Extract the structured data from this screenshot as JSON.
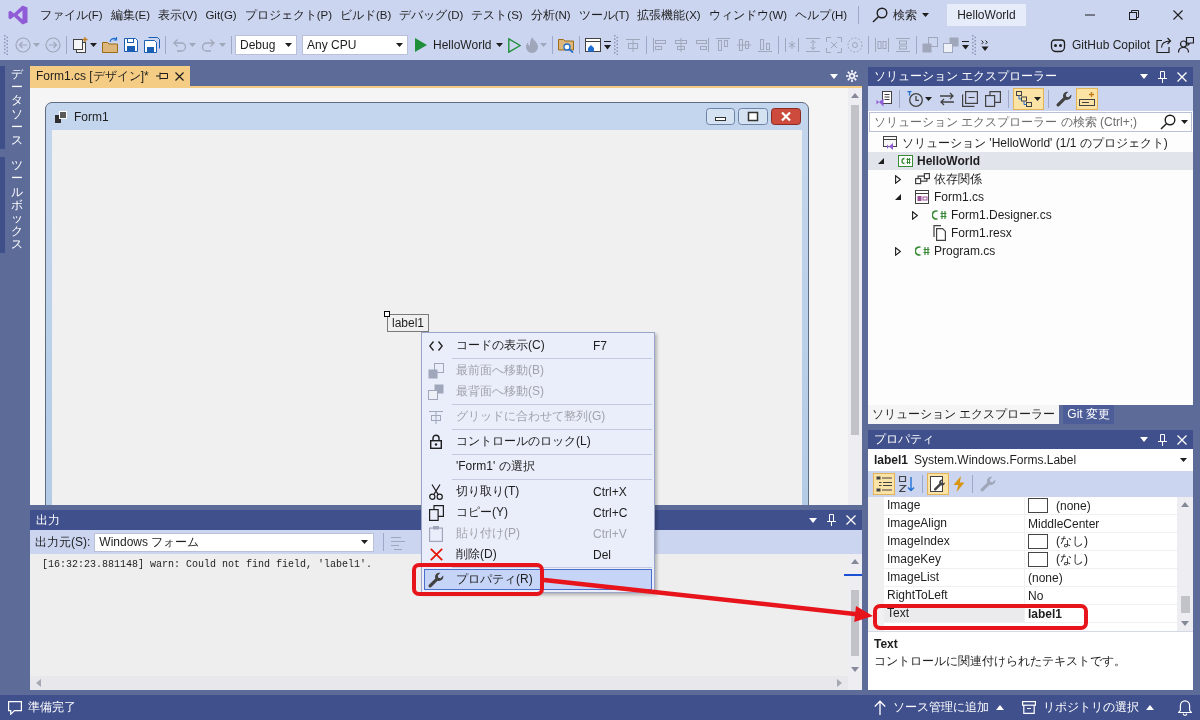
{
  "title_bar": {
    "menu": [
      "ファイル(F)",
      "編集(E)",
      "表示(V)",
      "Git(G)",
      "プロジェクト(P)",
      "ビルド(B)",
      "デバッグ(D)",
      "テスト(S)",
      "分析(N)",
      "ツール(T)",
      "拡張機能(X)",
      "ウィンドウ(W)",
      "ヘルプ(H)"
    ],
    "search": "検索",
    "solution": "HelloWorld"
  },
  "toolbar": {
    "bands": [
      {
        "collapsed": false,
        "groups": [
          [
            {
              "kind": "back",
              "disabled": true,
              "menu": true
            },
            {
              "kind": "forward",
              "disabled": true,
              "menu": false
            }
          ],
          [
            {
              "kind": "newitem",
              "disabled": false,
              "menu": true
            },
            {
              "kind": "open",
              "disabled": false,
              "menu": false
            },
            {
              "kind": "save",
              "disabled": false,
              "menu": false
            },
            {
              "kind": "saveall",
              "disabled": false,
              "menu": false
            }
          ],
          [
            {
              "kind": "undo",
              "disabled": true,
              "menu": true
            },
            {
              "kind": "redo",
              "disabled": true,
              "menu": true
            }
          ],
          [
            {
              "kind": "combo",
              "value": "Debug",
              "disabled": false,
              "menu": true
            },
            {
              "kind": "combo",
              "value": "Any CPU",
              "disabled": false,
              "menu": true
            },
            {
              "kind": "run",
              "label": "HelloWorld",
              "disabled": false,
              "menu": true
            },
            {
              "kind": "runnodebug",
              "disabled": false,
              "menu": false
            },
            {
              "kind": "hotreload",
              "disabled": true,
              "menu": true
            }
          ],
          [
            {
              "kind": "findfiles",
              "disabled": false,
              "menu": false
            }
          ],
          [
            {
              "kind": "window",
              "disabled": false,
              "menu": false
            }
          ]
        ]
      },
      {
        "collapsed": false,
        "groups": [
          [
            {
              "kind": "aligngrid",
              "disabled": true,
              "menu": false
            }
          ],
          [
            {
              "kind": "alignleft",
              "disabled": true,
              "menu": false
            },
            {
              "kind": "aligncenter",
              "disabled": true,
              "menu": false
            },
            {
              "kind": "alignright",
              "disabled": true,
              "menu": false
            },
            {
              "kind": "aligntop",
              "disabled": true,
              "menu": false
            },
            {
              "kind": "alignmiddle",
              "disabled": true,
              "menu": false
            },
            {
              "kind": "alignbottom",
              "disabled": true,
              "menu": false
            }
          ],
          [
            {
              "kind": "samewidth",
              "disabled": true,
              "menu": false
            },
            {
              "kind": "sameheight",
              "disabled": true,
              "menu": false
            },
            {
              "kind": "samesize",
              "disabled": true,
              "menu": false
            },
            {
              "kind": "sizegrid",
              "disabled": true,
              "menu": false
            }
          ],
          [
            {
              "kind": "hspace",
              "disabled": true,
              "menu": false
            },
            {
              "kind": "vspace",
              "disabled": true,
              "menu": false
            }
          ],
          [
            {
              "kind": "front",
              "disabled": true,
              "menu": false
            },
            {
              "kind": "sendback",
              "disabled": true,
              "menu": false
            }
          ]
        ]
      },
      {
        "collapsed": true
      }
    ],
    "extras": [
      {
        "kind": "copilot",
        "label": "GitHub Copilot"
      },
      {
        "kind": "share"
      },
      {
        "kind": "feedback"
      }
    ]
  },
  "side_tabs": [
    "データソース",
    "ツールボックス"
  ],
  "document": {
    "tabs": [
      {
        "label": "Form1.cs [デザイン]*",
        "selected": true
      }
    ],
    "form": {
      "title": "Form1",
      "controls": [
        {
          "kind": "label",
          "text": "label1",
          "selected": true
        }
      ]
    }
  },
  "context_menu": {
    "groups": [
      [
        {
          "label": "コードの表示(C)",
          "shortcut": "F7",
          "disabled": false,
          "selected": false,
          "annotated": false
        }
      ],
      [
        {
          "label": "最前面へ移動(B)",
          "disabled": true,
          "selected": false,
          "annotated": false
        },
        {
          "label": "最背面へ移動(S)",
          "disabled": true,
          "selected": false,
          "annotated": false
        }
      ],
      [
        {
          "label": "グリッドに合わせて整列(G)",
          "disabled": true,
          "selected": false,
          "annotated": false
        }
      ],
      [
        {
          "label": "コントロールのロック(L)",
          "disabled": false,
          "selected": false,
          "annotated": false
        }
      ],
      [
        {
          "label": "'Form1' の選択",
          "disabled": false,
          "selected": false,
          "annotated": false
        }
      ],
      [
        {
          "label": "切り取り(T)",
          "shortcut": "Ctrl+X",
          "disabled": false,
          "selected": false,
          "annotated": false
        },
        {
          "label": "コピー(Y)",
          "shortcut": "Ctrl+C",
          "disabled": false,
          "selected": false,
          "annotated": false
        },
        {
          "label": "貼り付け(P)",
          "shortcut": "Ctrl+V",
          "disabled": true,
          "selected": false,
          "annotated": false
        },
        {
          "label": "削除(D)",
          "shortcut": "Del",
          "disabled": false,
          "selected": false,
          "annotated": false
        }
      ],
      [
        {
          "label": "プロパティ(R)",
          "disabled": false,
          "selected": true,
          "annotated": true
        }
      ]
    ]
  },
  "output": {
    "title": "出力",
    "source_label": "出力元(S):",
    "source": "Windows フォーム",
    "toolbar": [
      {
        "kind": "clearlines",
        "disabled": true
      }
    ],
    "lines": [
      "[16:32:23.881148] warn: Could not find field, 'label1'."
    ]
  },
  "solution_explorer": {
    "title": "ソリューション エクスプローラー",
    "toolbar": [
      [
        {
          "kind": "views",
          "selected": false,
          "menu": false
        }
      ],
      [
        {
          "kind": "pending",
          "selected": false,
          "menu": true
        },
        {
          "kind": "sync",
          "selected": false,
          "menu": false
        },
        {
          "kind": "collapse",
          "selected": false,
          "menu": false
        },
        {
          "kind": "showall",
          "selected": false,
          "menu": false
        }
      ],
      [
        {
          "kind": "tree",
          "selected": true,
          "menu": true
        }
      ],
      [
        {
          "kind": "wrench",
          "selected": false,
          "menu": false
        },
        {
          "kind": "preview",
          "selected": true,
          "menu": false
        }
      ]
    ],
    "search": {
      "placeholder": "ソリューション エクスプローラー の検索 (Ctrl+;)"
    },
    "tree": [
      {
        "label": "ソリューション 'HelloWorld' (1/1 のプロジェクト)",
        "kind": "solution",
        "expandable": false,
        "expanded": true,
        "selected": false,
        "children": [
          {
            "label": "HelloWorld",
            "kind": "project",
            "expandable": true,
            "expanded": true,
            "selected": true,
            "children": [
              {
                "label": "依存関係",
                "kind": "dependencies",
                "expandable": true,
                "expanded": false,
                "selected": false
              },
              {
                "label": "Form1.cs",
                "kind": "form",
                "expandable": true,
                "expanded": true,
                "selected": false,
                "children": [
                  {
                    "label": "Form1.Designer.cs",
                    "kind": "csharp",
                    "expandable": true,
                    "expanded": false,
                    "selected": false
                  },
                  {
                    "label": "Form1.resx",
                    "kind": "resource",
                    "expandable": false,
                    "selected": false
                  }
                ]
              },
              {
                "label": "Program.cs",
                "kind": "csharp",
                "expandable": true,
                "expanded": false,
                "selected": false
              }
            ]
          }
        ]
      }
    ],
    "tabs": [
      {
        "label": "ソリューション エクスプローラー",
        "selected": true
      },
      {
        "label": "Git 変更",
        "selected": false
      }
    ]
  },
  "properties": {
    "title": "プロパティ",
    "object": {
      "name": "label1",
      "type": "System.Windows.Forms.Label"
    },
    "toolbar": [
      [
        {
          "kind": "categorized",
          "selected": true,
          "disabled": false
        },
        {
          "kind": "alphabetical",
          "selected": false,
          "disabled": false
        }
      ],
      [
        {
          "kind": "properties",
          "selected": true,
          "disabled": false
        },
        {
          "kind": "events",
          "selected": false,
          "disabled": false
        }
      ],
      [
        {
          "kind": "pages",
          "selected": false,
          "disabled": true
        }
      ]
    ],
    "rows": [
      {
        "name": "Image",
        "value": "(none)",
        "kind": "preview",
        "selected": false,
        "modified": false,
        "annotated": false
      },
      {
        "name": "ImageAlign",
        "value": "MiddleCenter",
        "kind": "plain",
        "selected": false,
        "modified": false,
        "annotated": false
      },
      {
        "name": "ImageIndex",
        "value": "(なし)",
        "kind": "preview",
        "selected": false,
        "modified": false,
        "annotated": false
      },
      {
        "name": "ImageKey",
        "value": "(なし)",
        "kind": "preview",
        "selected": false,
        "modified": false,
        "annotated": false
      },
      {
        "name": "ImageList",
        "value": "(none)",
        "kind": "plain",
        "selected": false,
        "modified": false,
        "annotated": false
      },
      {
        "name": "RightToLeft",
        "value": "No",
        "kind": "plain",
        "selected": false,
        "modified": false,
        "annotated": false
      },
      {
        "name": "Text",
        "value": "label1",
        "kind": "plain",
        "selected": true,
        "modified": true,
        "annotated": true
      }
    ],
    "description": {
      "title": "Text",
      "text": "コントロールに関連付けられたテキストです。"
    }
  },
  "status_bar": {
    "text": "準備完了",
    "actions": [
      {
        "kind": "add",
        "label": "ソース管理に追加"
      },
      {
        "kind": "repository",
        "label": "リポジトリの選択"
      }
    ]
  }
}
